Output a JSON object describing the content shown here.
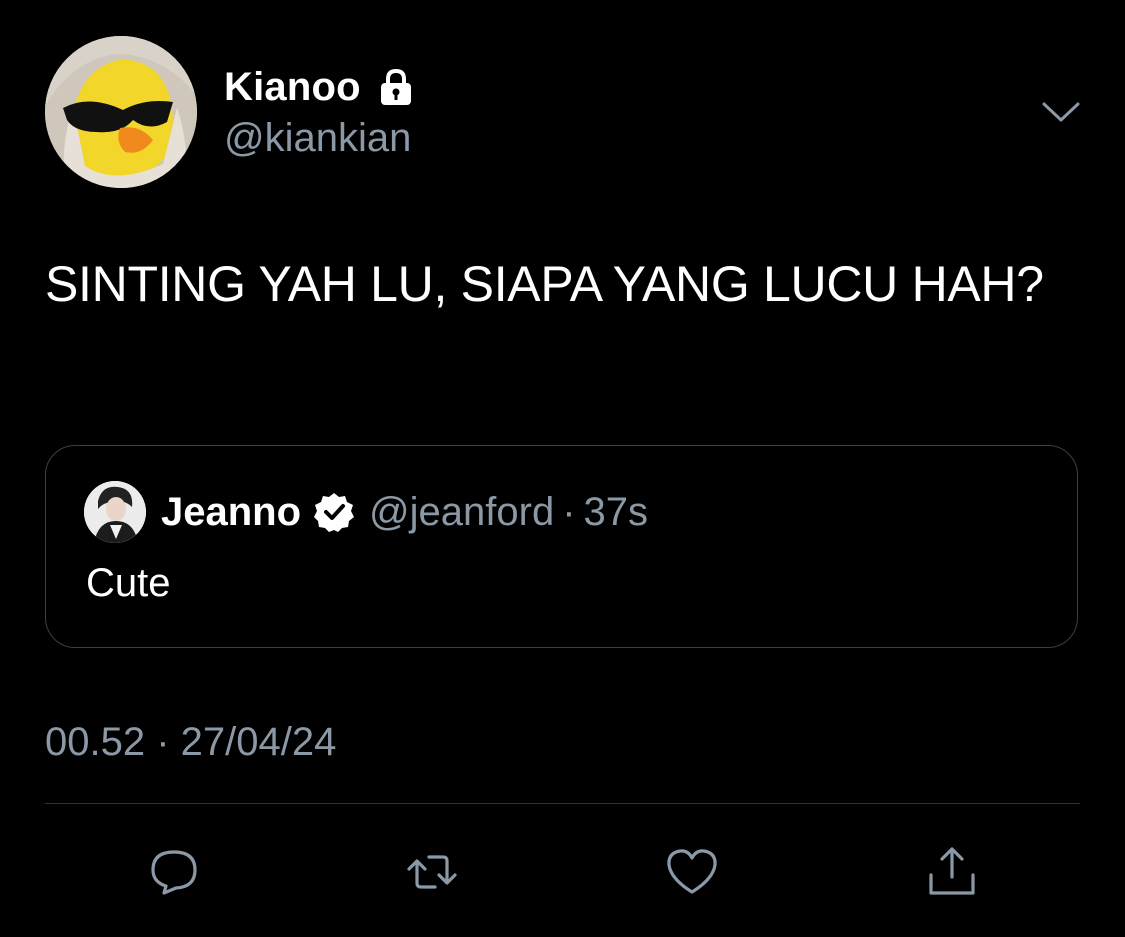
{
  "tweet": {
    "author": {
      "display_name": "Kianoo",
      "handle": "@kiankian",
      "protected_icon": "lock-icon"
    },
    "menu_icon": "chevron-down-icon",
    "text": "SINTING YAH LU, SIAPA YANG LUCU HAH?",
    "quoted": {
      "display_name": "Jeanno",
      "verified_icon": "verified-badge-icon",
      "handle": "@jeanford",
      "separator": "·",
      "time": "37s",
      "text": "Cute"
    },
    "timestamp": "00.52 · 27/04/24",
    "actions": [
      {
        "name": "reply",
        "icon": "reply-bubble-icon"
      },
      {
        "name": "retweet",
        "icon": "retweet-icon"
      },
      {
        "name": "like",
        "icon": "heart-icon"
      },
      {
        "name": "share",
        "icon": "share-icon"
      }
    ]
  },
  "colors": {
    "background": "#000000",
    "primary_text": "#ffffff",
    "secondary_text": "#8b98a5",
    "border": "#3a3f44",
    "divider": "#2f3336"
  }
}
